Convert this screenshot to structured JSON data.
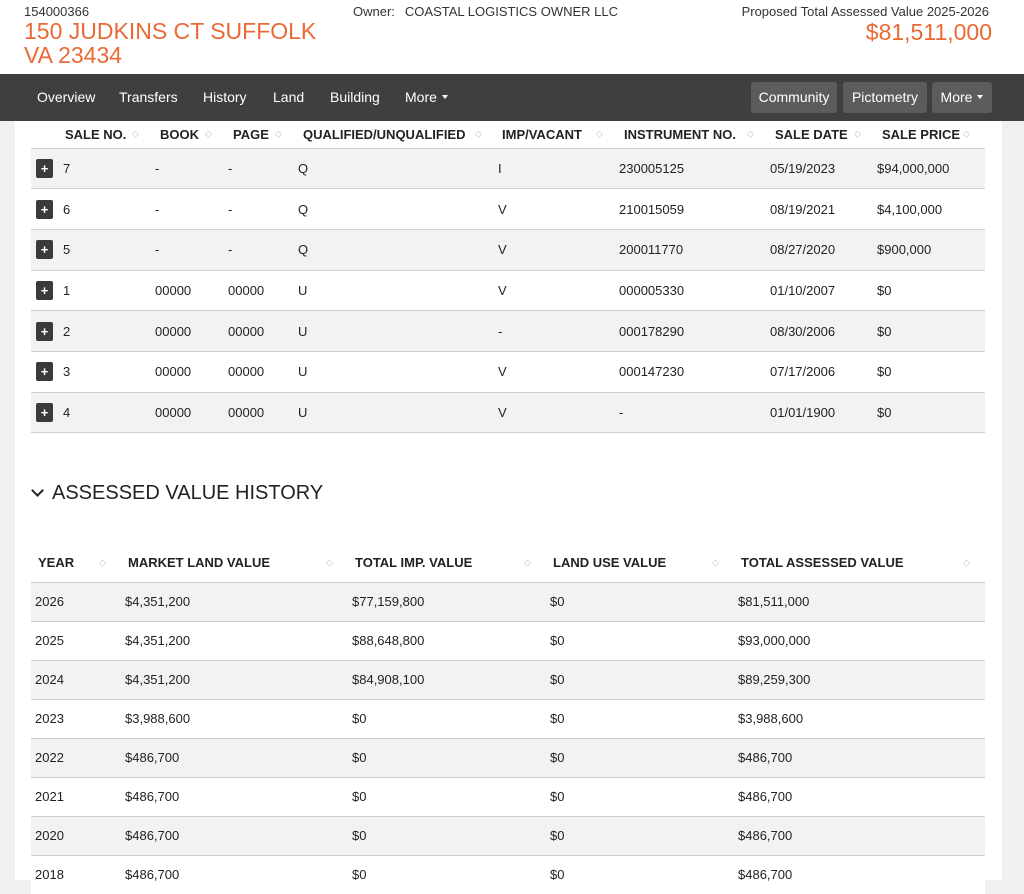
{
  "header": {
    "parcel_id": "154000366",
    "address_line1": "150 JUDKINS CT SUFFOLK",
    "address_line2": "VA 23434",
    "owner_label": "Owner:",
    "owner_name": "COASTAL LOGISTICS OWNER LLC",
    "value_label": "Proposed Total Assessed Value 2025-2026",
    "value_amount": "$81,511,000",
    "accent_color": "#ea6a35"
  },
  "nav": {
    "items": [
      "Overview",
      "Transfers",
      "History",
      "Land",
      "Building",
      "More"
    ],
    "buttons": [
      "Community",
      "Pictometry",
      "More"
    ]
  },
  "sales": {
    "columns": [
      "SALE NO.",
      "BOOK",
      "PAGE",
      "QUALIFIED/UNQUALIFIED",
      "IMP/VACANT",
      "INSTRUMENT NO.",
      "SALE DATE",
      "SALE PRICE"
    ],
    "rows": [
      [
        "7",
        "-",
        "-",
        "Q",
        "I",
        "230005125",
        "05/19/2023",
        "$94,000,000"
      ],
      [
        "6",
        "-",
        "-",
        "Q",
        "V",
        "210015059",
        "08/19/2021",
        "$4,100,000"
      ],
      [
        "5",
        "-",
        "-",
        "Q",
        "V",
        "200011770",
        "08/27/2020",
        "$900,000"
      ],
      [
        "1",
        "00000",
        "00000",
        "U",
        "V",
        "000005330",
        "01/10/2007",
        "$0"
      ],
      [
        "2",
        "00000",
        "00000",
        "U",
        "-",
        "000178290",
        "08/30/2006",
        "$0"
      ],
      [
        "3",
        "00000",
        "00000",
        "U",
        "V",
        "000147230",
        "07/17/2006",
        "$0"
      ],
      [
        "4",
        "00000",
        "00000",
        "U",
        "V",
        "-",
        "01/01/1900",
        "$0"
      ]
    ]
  },
  "assessed": {
    "title": "ASSESSED VALUE HISTORY",
    "columns": [
      "YEAR",
      "MARKET LAND VALUE",
      "TOTAL IMP. VALUE",
      "LAND USE VALUE",
      "TOTAL ASSESSED VALUE"
    ],
    "rows": [
      [
        "2026",
        "$4,351,200",
        "$77,159,800",
        "$0",
        "$81,511,000"
      ],
      [
        "2025",
        "$4,351,200",
        "$88,648,800",
        "$0",
        "$93,000,000"
      ],
      [
        "2024",
        "$4,351,200",
        "$84,908,100",
        "$0",
        "$89,259,300"
      ],
      [
        "2023",
        "$3,988,600",
        "$0",
        "$0",
        "$3,988,600"
      ],
      [
        "2022",
        "$486,700",
        "$0",
        "$0",
        "$486,700"
      ],
      [
        "2021",
        "$486,700",
        "$0",
        "$0",
        "$486,700"
      ],
      [
        "2020",
        "$486,700",
        "$0",
        "$0",
        "$486,700"
      ],
      [
        "2018",
        "$486,700",
        "$0",
        "$0",
        "$486,700"
      ]
    ]
  },
  "icons": {
    "expand": "+",
    "sort": "◇"
  }
}
